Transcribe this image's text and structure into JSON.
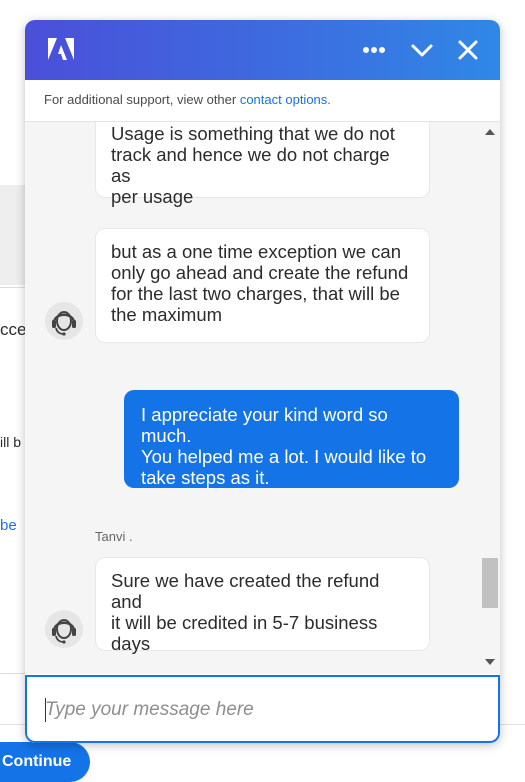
{
  "background_page": {
    "cut_text_1": "cce",
    "cut_text_2": "ill b",
    "cut_link": "be",
    "continue_label": "Continue"
  },
  "chat": {
    "header": {
      "logo": "adobe-logo",
      "icons": [
        "more-icon",
        "chevron-down-icon",
        "close-icon"
      ]
    },
    "support": {
      "prefix": "For additional support, view other ",
      "link": "contact options."
    },
    "messages": [
      {
        "from": "agent",
        "text": "Usage is something that we do not\ntrack and hence we do not charge as\nper usage"
      },
      {
        "from": "agent",
        "text": "but as a one time exception we can\nonly go ahead and create the refund\nfor the last two charges, that will be\nthe maximum"
      },
      {
        "from": "user",
        "text": "I appreciate your kind word so much.\nYou helped me a lot.  I would like to\ntake steps as it."
      },
      {
        "from": "agent",
        "name": "Tanvi .",
        "text": "Sure we have created the refund and\nit will be credited in 5-7 business\ndays"
      }
    ],
    "input": {
      "placeholder": "Type your message here",
      "value": ""
    },
    "colors": {
      "header_start": "#4b4fd9",
      "header_end": "#2f88e6",
      "accent": "#1473e6"
    }
  }
}
